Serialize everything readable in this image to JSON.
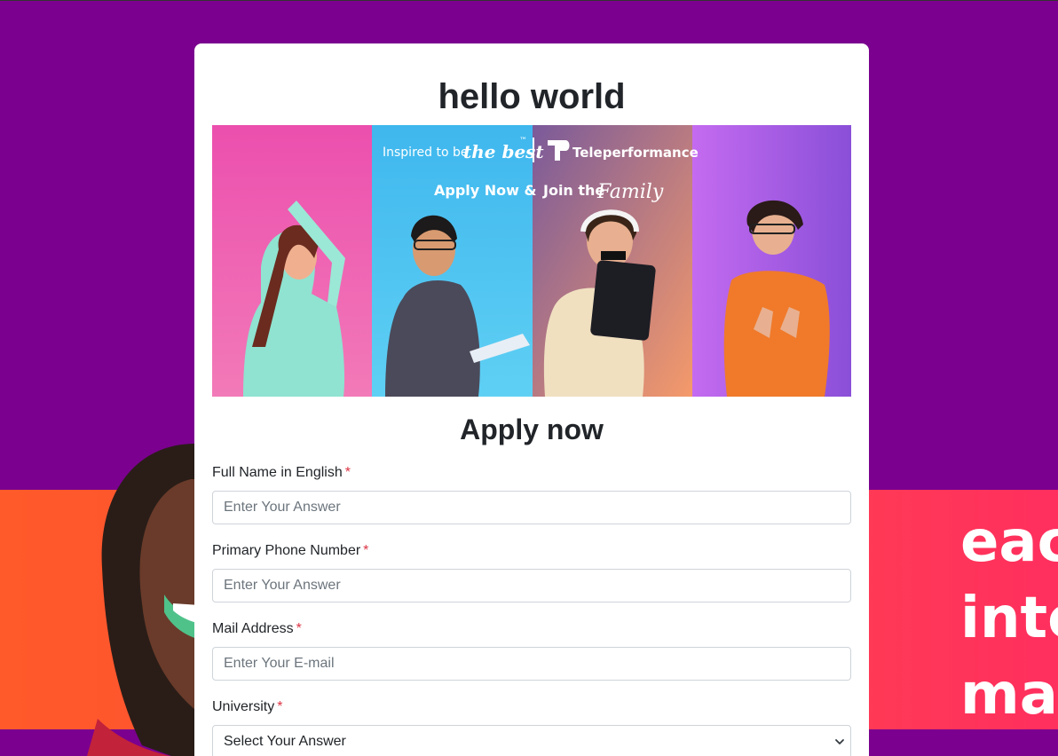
{
  "page": {
    "background_color": "#7b008f"
  },
  "background": {
    "band_text": [
      "eac",
      "inte",
      "mat"
    ]
  },
  "card": {
    "title": "hello world",
    "banner": {
      "tagline_prefix": "Inspired to be",
      "tagline_emph": "the best",
      "trademark": "™",
      "brand": "Teleperformance",
      "cta_prefix": "Apply Now &",
      "cta_mid": "Join the",
      "cta_emph": "Family"
    },
    "form_title": "Apply now",
    "fields": [
      {
        "label": "Full Name in English",
        "required_mark": "*",
        "placeholder": "Enter Your Answer"
      },
      {
        "label": "Primary Phone Number",
        "required_mark": "*",
        "placeholder": "Enter Your Answer"
      },
      {
        "label": "Mail Address",
        "required_mark": "*",
        "placeholder": "Enter Your E-mail"
      },
      {
        "label": "University",
        "required_mark": "*",
        "selected": "Select Your Answer"
      }
    ]
  },
  "colors": {
    "required": "#dc3545",
    "band_orange": "#ff5a2a",
    "band_red": "#ff2f5e"
  }
}
